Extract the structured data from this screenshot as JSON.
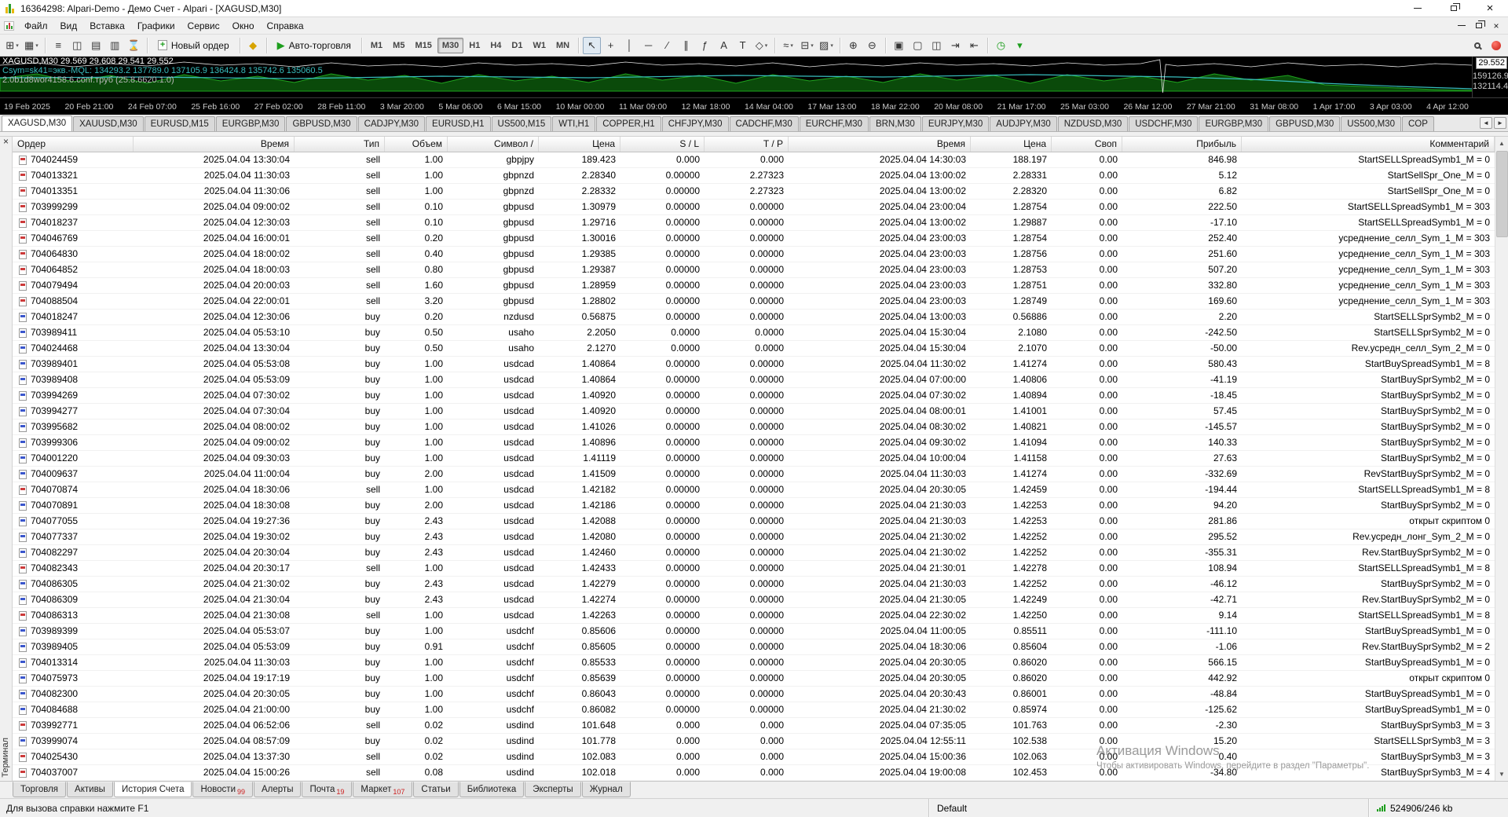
{
  "colors": {
    "sell": "#cc3a3a",
    "buy": "#3a56cc",
    "green": "#1d9e1d",
    "badge": "#cc2020",
    "chart_green": "#1fa51f",
    "chart_green_dark": "#0a4a0a",
    "chart_teal": "#37bdbd",
    "chart_white": "#e6e6e6"
  },
  "window": {
    "title": "16364298: Alpari-Demo - Демо Счет - Alpari - [XAGUSD,M30]",
    "close_glyph": "×",
    "child_close_glyph": "×"
  },
  "menu": {
    "items": [
      "Файл",
      "Вид",
      "Вставка",
      "Графики",
      "Сервис",
      "Окно",
      "Справка"
    ]
  },
  "toolbar": {
    "new_order": {
      "label": "Новый ордер"
    },
    "autotrade": {
      "label": "Авто-торговля",
      "glyph": "▶"
    },
    "metaeditor": {
      "name": "metaeditor-icon",
      "glyph": "◆"
    },
    "chart_group": [
      {
        "name": "new-chart-button",
        "glyph": "⊞",
        "dropdown": "▾"
      },
      {
        "name": "profiles-button",
        "glyph": "▦",
        "dropdown": "▾"
      }
    ],
    "panel_group": [
      {
        "name": "market-watch-button",
        "glyph": "≡"
      },
      {
        "name": "data-window-button",
        "glyph": "◫"
      },
      {
        "name": "navigator-button",
        "glyph": "▤"
      },
      {
        "name": "terminal-button",
        "glyph": "▥"
      },
      {
        "name": "strategy-tester-button",
        "glyph": "⌛"
      }
    ],
    "timeframes": [
      {
        "name": "timeframe-m1-button",
        "label": "M1"
      },
      {
        "name": "timeframe-m5-button",
        "label": "M5"
      },
      {
        "name": "timeframe-m15-button",
        "label": "M15"
      },
      {
        "name": "timeframe-m30-button",
        "label": "M30",
        "active": true
      },
      {
        "name": "timeframe-h1-button",
        "label": "H1"
      },
      {
        "name": "timeframe-h4-button",
        "label": "H4"
      },
      {
        "name": "timeframe-d1-button",
        "label": "D1"
      },
      {
        "name": "timeframe-w1-button",
        "label": "W1"
      },
      {
        "name": "timeframe-mn-button",
        "label": "MN"
      }
    ],
    "draw_group": [
      {
        "name": "cursor-button",
        "glyph": "↖",
        "active": true
      },
      {
        "name": "crosshair-button",
        "glyph": "+"
      },
      {
        "name": "vertical-line-button",
        "glyph": "│"
      },
      {
        "name": "horizontal-line-button",
        "glyph": "─"
      },
      {
        "name": "trendline-button",
        "glyph": "∕"
      },
      {
        "name": "channel-button",
        "glyph": "∥"
      },
      {
        "name": "fibonacci-button",
        "glyph": "ƒ"
      },
      {
        "name": "text-button",
        "glyph": "A"
      },
      {
        "name": "label-button",
        "glyph": "T"
      },
      {
        "name": "shapes-button",
        "glyph": "◇",
        "dropdown": "▾"
      }
    ],
    "chart_tools_group": [
      {
        "name": "indicators-button",
        "glyph": "≈",
        "dropdown": "▾"
      },
      {
        "name": "periodicity-button",
        "glyph": "⊟",
        "dropdown": "▾"
      },
      {
        "name": "templates-button",
        "glyph": "▨",
        "dropdown": "▾"
      }
    ],
    "zoom_group": [
      {
        "name": "zoom-in-button",
        "glyph": "⊕"
      },
      {
        "name": "zoom-out-button",
        "glyph": "⊖"
      }
    ],
    "window_group": [
      {
        "name": "tile-windows-button",
        "glyph": "▣"
      },
      {
        "name": "cascade-windows-button",
        "glyph": "▢"
      },
      {
        "name": "tile-vertical-button",
        "glyph": "◫"
      },
      {
        "name": "auto-scroll-button",
        "glyph": "⇥"
      },
      {
        "name": "chart-shift-button",
        "glyph": "⇤"
      }
    ],
    "misc_group": [
      {
        "name": "scheduler-button",
        "glyph": "◷",
        "cls": "green-glyph"
      },
      {
        "name": "toolbar-options-button",
        "glyph": "▾"
      }
    ]
  },
  "chart": {
    "info_line1": "XAGUSD,M30  29.569 29.608 29.541 29.552",
    "info_line2": "Csym=sk41=экв.-MQL: 134293.2  137789.0  137105.9  136424.8  135742.6  135060.5",
    "info_line3": "2.0b1d8wor4158.6.conf.труб (25.8.6620.1.0)",
    "price_box": "29.552",
    "scale_values": [
      "159126.9",
      "132114.4"
    ],
    "time_axis": [
      "19 Fe&#8203;b 2025",
      "20 Feb 21:00",
      "24 Feb 07:00",
      "25 Feb 16:00",
      "27 Feb 02:00",
      "28 Feb 11:00",
      "3 Mar 20:00",
      "5 Mar 06:00",
      "6 Mar 15:00",
      "10 Mar 00:00",
      "11 Mar 09:00",
      "12 Mar 18:00",
      "14 Mar 04:00",
      "17 Mar 13:00",
      "18 Mar 22:00",
      "20 Mar 08:00",
      "21 Mar 17:00",
      "25 Mar 03:00",
      "26 Mar 12:00",
      "27 Mar 21:00",
      "31 Mar 08:00",
      "1 Apr 17:00",
      "3 Apr 03:00",
      "4 Apr 12:00"
    ]
  },
  "chart_tabs_controls": {
    "left": "◄",
    "right": "►"
  },
  "chart_tabs": [
    {
      "label": "XAGUSD,M30",
      "active": true
    },
    {
      "label": "XAUUSD,M30"
    },
    {
      "label": "EURUSD,M15"
    },
    {
      "label": "EURGBP,M30"
    },
    {
      "label": "GBPUSD,M30"
    },
    {
      "label": "CADJPY,M30"
    },
    {
      "label": "EURUSD,H1"
    },
    {
      "label": "US500,M15"
    },
    {
      "label": "WTI,H1"
    },
    {
      "label": "COPPER,H1"
    },
    {
      "label": "CHFJPY,M30"
    },
    {
      "label": "CADCHF,M30"
    },
    {
      "label": "EURCHF,M30"
    },
    {
      "label": "BRN,M30"
    },
    {
      "label": "EURJPY,M30"
    },
    {
      "label": "AUDJPY,M30"
    },
    {
      "label": "NZDUSD,M30"
    },
    {
      "label": "USDCHF,M30"
    },
    {
      "label": "EURGBP,M30"
    },
    {
      "label": "GBPUSD,M30"
    },
    {
      "label": "US500,M30"
    },
    {
      "label": "COP"
    }
  ],
  "terminal": {
    "caption": "Терминал",
    "close_glyph": "×",
    "scroll_up": "▲",
    "scroll_down": "▼",
    "columns": [
      {
        "label": "Ордер"
      },
      {
        "label": "Время"
      },
      {
        "label": "Тип"
      },
      {
        "label": "Объем"
      },
      {
        "label": "Символ /"
      },
      {
        "label": "Цена"
      },
      {
        "label": "S / L"
      },
      {
        "label": "T / P"
      },
      {
        "label": "Время"
      },
      {
        "label": "Цена"
      },
      {
        "label": "Своп"
      },
      {
        "label": "Прибыль"
      },
      {
        "label": "Комментарий"
      }
    ],
    "rows": [
      [
        "704024459",
        "2025.04.04 13:30:04",
        "sell",
        "1.00",
        "gbpjpy",
        "189.423",
        "0.000",
        "0.000",
        "2025.04.04 14:30:03",
        "188.197",
        "0.00",
        "846.98",
        "StartSELLSpreadSymb1_M = 0"
      ],
      [
        "704013321",
        "2025.04.04 11:30:03",
        "sell",
        "1.00",
        "gbpnzd",
        "2.28340",
        "0.00000",
        "2.27323",
        "2025.04.04 13:00:02",
        "2.28331",
        "0.00",
        "5.12",
        "StartSellSpr_One_M = 0"
      ],
      [
        "704013351",
        "2025.04.04 11:30:06",
        "sell",
        "1.00",
        "gbpnzd",
        "2.28332",
        "0.00000",
        "2.27323",
        "2025.04.04 13:00:02",
        "2.28320",
        "0.00",
        "6.82",
        "StartSellSpr_One_M = 0"
      ],
      [
        "703999299",
        "2025.04.04 09:00:02",
        "sell",
        "0.10",
        "gbpusd",
        "1.30979",
        "0.00000",
        "0.00000",
        "2025.04.04 23:00:04",
        "1.28754",
        "0.00",
        "222.50",
        "StartSELLSpreadSymb1_M = 303"
      ],
      [
        "704018237",
        "2025.04.04 12:30:03",
        "sell",
        "0.10",
        "gbpusd",
        "1.29716",
        "0.00000",
        "0.00000",
        "2025.04.04 13:00:02",
        "1.29887",
        "0.00",
        "-17.10",
        "StartSELLSpreadSymb1_M = 0"
      ],
      [
        "704046769",
        "2025.04.04 16:00:01",
        "sell",
        "0.20",
        "gbpusd",
        "1.30016",
        "0.00000",
        "0.00000",
        "2025.04.04 23:00:03",
        "1.28754",
        "0.00",
        "252.40",
        "усреднение_селл_Sym_1_M = 303"
      ],
      [
        "704064830",
        "2025.04.04 18:00:02",
        "sell",
        "0.40",
        "gbpusd",
        "1.29385",
        "0.00000",
        "0.00000",
        "2025.04.04 23:00:03",
        "1.28756",
        "0.00",
        "251.60",
        "усреднение_селл_Sym_1_M = 303"
      ],
      [
        "704064852",
        "2025.04.04 18:00:03",
        "sell",
        "0.80",
        "gbpusd",
        "1.29387",
        "0.00000",
        "0.00000",
        "2025.04.04 23:00:03",
        "1.28753",
        "0.00",
        "507.20",
        "усреднение_селл_Sym_1_M = 303"
      ],
      [
        "704079494",
        "2025.04.04 20:00:03",
        "sell",
        "1.60",
        "gbpusd",
        "1.28959",
        "0.00000",
        "0.00000",
        "2025.04.04 23:00:03",
        "1.28751",
        "0.00",
        "332.80",
        "усреднение_селл_Sym_1_M = 303"
      ],
      [
        "704088504",
        "2025.04.04 22:00:01",
        "sell",
        "3.20",
        "gbpusd",
        "1.28802",
        "0.00000",
        "0.00000",
        "2025.04.04 23:00:03",
        "1.28749",
        "0.00",
        "169.60",
        "усреднение_селл_Sym_1_M = 303"
      ],
      [
        "704018247",
        "2025.04.04 12:30:06",
        "buy",
        "0.20",
        "nzdusd",
        "0.56875",
        "0.00000",
        "0.00000",
        "2025.04.04 13:00:03",
        "0.56886",
        "0.00",
        "2.20",
        "StartSELLSprSymb2_M = 0"
      ],
      [
        "703989411",
        "2025.04.04 05:53:10",
        "buy",
        "0.50",
        "usaho",
        "2.2050",
        "0.0000",
        "0.0000",
        "2025.04.04 15:30:04",
        "2.1080",
        "0.00",
        "-242.50",
        "StartSELLSprSymb2_M = 0"
      ],
      [
        "704024468",
        "2025.04.04 13:30:04",
        "buy",
        "0.50",
        "usaho",
        "2.1270",
        "0.0000",
        "0.0000",
        "2025.04.04 15:30:04",
        "2.1070",
        "0.00",
        "-50.00",
        "Rev.усредн_селл_Sym_2_M = 0"
      ],
      [
        "703989401",
        "2025.04.04 05:53:08",
        "buy",
        "1.00",
        "usdcad",
        "1.40864",
        "0.00000",
        "0.00000",
        "2025.04.04 11:30:02",
        "1.41274",
        "0.00",
        "580.43",
        "StartBuySpreadSymb1_M = 8"
      ],
      [
        "703989408",
        "2025.04.04 05:53:09",
        "buy",
        "1.00",
        "usdcad",
        "1.40864",
        "0.00000",
        "0.00000",
        "2025.04.04 07:00:00",
        "1.40806",
        "0.00",
        "-41.19",
        "StartBuySprSymb2_M = 0"
      ],
      [
        "703994269",
        "2025.04.04 07:30:02",
        "buy",
        "1.00",
        "usdcad",
        "1.40920",
        "0.00000",
        "0.00000",
        "2025.04.04 07:30:02",
        "1.40894",
        "0.00",
        "-18.45",
        "StartBuySprSymb2_M = 0"
      ],
      [
        "703994277",
        "2025.04.04 07:30:04",
        "buy",
        "1.00",
        "usdcad",
        "1.40920",
        "0.00000",
        "0.00000",
        "2025.04.04 08:00:01",
        "1.41001",
        "0.00",
        "57.45",
        "StartBuySprSymb2_M = 0"
      ],
      [
        "703995682",
        "2025.04.04 08:00:02",
        "buy",
        "1.00",
        "usdcad",
        "1.41026",
        "0.00000",
        "0.00000",
        "2025.04.04 08:30:02",
        "1.40821",
        "0.00",
        "-145.57",
        "StartBuySprSymb2_M = 0"
      ],
      [
        "703999306",
        "2025.04.04 09:00:02",
        "buy",
        "1.00",
        "usdcad",
        "1.40896",
        "0.00000",
        "0.00000",
        "2025.04.04 09:30:02",
        "1.41094",
        "0.00",
        "140.33",
        "StartBuySprSymb2_M = 0"
      ],
      [
        "704001220",
        "2025.04.04 09:30:03",
        "buy",
        "1.00",
        "usdcad",
        "1.41119",
        "0.00000",
        "0.00000",
        "2025.04.04 10:00:04",
        "1.41158",
        "0.00",
        "27.63",
        "StartBuySprSymb2_M = 0"
      ],
      [
        "704009637",
        "2025.04.04 11:00:04",
        "buy",
        "2.00",
        "usdcad",
        "1.41509",
        "0.00000",
        "0.00000",
        "2025.04.04 11:30:03",
        "1.41274",
        "0.00",
        "-332.69",
        "RevStartBuySprSymb2_M = 0"
      ],
      [
        "704070874",
        "2025.04.04 18:30:06",
        "sell",
        "1.00",
        "usdcad",
        "1.42182",
        "0.00000",
        "0.00000",
        "2025.04.04 20:30:05",
        "1.42459",
        "0.00",
        "-194.44",
        "StartSELLSpreadSymb1_M = 8"
      ],
      [
        "704070891",
        "2025.04.04 18:30:08",
        "buy",
        "2.00",
        "usdcad",
        "1.42186",
        "0.00000",
        "0.00000",
        "2025.04.04 21:30:03",
        "1.42253",
        "0.00",
        "94.20",
        "StartBuySprSymb2_M = 0"
      ],
      [
        "704077055",
        "2025.04.04 19:27:36",
        "buy",
        "2.43",
        "usdcad",
        "1.42088",
        "0.00000",
        "0.00000",
        "2025.04.04 21:30:03",
        "1.42253",
        "0.00",
        "281.86",
        "открыт скриптом 0"
      ],
      [
        "704077337",
        "2025.04.04 19:30:02",
        "buy",
        "2.43",
        "usdcad",
        "1.42080",
        "0.00000",
        "0.00000",
        "2025.04.04 21:30:02",
        "1.42252",
        "0.00",
        "295.52",
        "Rev.усредн_лонг_Sym_2_M = 0"
      ],
      [
        "704082297",
        "2025.04.04 20:30:04",
        "buy",
        "2.43",
        "usdcad",
        "1.42460",
        "0.00000",
        "0.00000",
        "2025.04.04 21:30:02",
        "1.42252",
        "0.00",
        "-355.31",
        "Rev.StartBuySprSymb2_M = 0"
      ],
      [
        "704082343",
        "2025.04.04 20:30:17",
        "sell",
        "1.00",
        "usdcad",
        "1.42433",
        "0.00000",
        "0.00000",
        "2025.04.04 21:30:01",
        "1.42278",
        "0.00",
        "108.94",
        "StartSELLSpreadSymb1_M = 8"
      ],
      [
        "704086305",
        "2025.04.04 21:30:02",
        "buy",
        "2.43",
        "usdcad",
        "1.42279",
        "0.00000",
        "0.00000",
        "2025.04.04 21:30:03",
        "1.42252",
        "0.00",
        "-46.12",
        "StartBuySprSymb2_M = 0"
      ],
      [
        "704086309",
        "2025.04.04 21:30:04",
        "buy",
        "2.43",
        "usdcad",
        "1.42274",
        "0.00000",
        "0.00000",
        "2025.04.04 21:30:05",
        "1.42249",
        "0.00",
        "-42.71",
        "Rev.StartBuySprSymb2_M = 0"
      ],
      [
        "704086313",
        "2025.04.04 21:30:08",
        "sell",
        "1.00",
        "usdcad",
        "1.42263",
        "0.00000",
        "0.00000",
        "2025.04.04 22:30:02",
        "1.42250",
        "0.00",
        "9.14",
        "StartSELLSpreadSymb1_M = 8"
      ],
      [
        "703989399",
        "2025.04.04 05:53:07",
        "buy",
        "1.00",
        "usdchf",
        "0.85606",
        "0.00000",
        "0.00000",
        "2025.04.04 11:00:05",
        "0.85511",
        "0.00",
        "-111.10",
        "StartBuySpreadSymb1_M = 0"
      ],
      [
        "703989405",
        "2025.04.04 05:53:09",
        "buy",
        "0.91",
        "usdchf",
        "0.85605",
        "0.00000",
        "0.00000",
        "2025.04.04 18:30:06",
        "0.85604",
        "0.00",
        "-1.06",
        "Rev.StartBuySprSymb2_M = 2"
      ],
      [
        "704013314",
        "2025.04.04 11:30:03",
        "buy",
        "1.00",
        "usdchf",
        "0.85533",
        "0.00000",
        "0.00000",
        "2025.04.04 20:30:05",
        "0.86020",
        "0.00",
        "566.15",
        "StartBuySpreadSymb1_M = 0"
      ],
      [
        "704075973",
        "2025.04.04 19:17:19",
        "buy",
        "1.00",
        "usdchf",
        "0.85639",
        "0.00000",
        "0.00000",
        "2025.04.04 20:30:05",
        "0.86020",
        "0.00",
        "442.92",
        "открыт скриптом 0"
      ],
      [
        "704082300",
        "2025.04.04 20:30:05",
        "buy",
        "1.00",
        "usdchf",
        "0.86043",
        "0.00000",
        "0.00000",
        "2025.04.04 20:30:43",
        "0.86001",
        "0.00",
        "-48.84",
        "StartBuySpreadSymb1_M = 0"
      ],
      [
        "704084688",
        "2025.04.04 21:00:00",
        "buy",
        "1.00",
        "usdchf",
        "0.86082",
        "0.00000",
        "0.00000",
        "2025.04.04 21:30:02",
        "0.85974",
        "0.00",
        "-125.62",
        "StartBuySpreadSymb1_M = 0"
      ],
      [
        "703992771",
        "2025.04.04 06:52:06",
        "sell",
        "0.02",
        "usdind",
        "101.648",
        "0.000",
        "0.000",
        "2025.04.04 07:35:05",
        "101.763",
        "0.00",
        "-2.30",
        "StartBuySprSymb3_M = 3"
      ],
      [
        "703999074",
        "2025.04.04 08:57:09",
        "buy",
        "0.02",
        "usdind",
        "101.778",
        "0.000",
        "0.000",
        "2025.04.04 12:55:11",
        "102.538",
        "0.00",
        "15.20",
        "StartSELLSprSymb3_M = 3"
      ],
      [
        "704025430",
        "2025.04.04 13:37:30",
        "sell",
        "0.02",
        "usdind",
        "102.083",
        "0.000",
        "0.000",
        "2025.04.04 15:00:36",
        "102.063",
        "0.00",
        "0.40",
        "StartBuySprSymb3_M = 3"
      ],
      [
        "704037007",
        "2025.04.04 15:00:26",
        "sell",
        "0.08",
        "usdind",
        "102.018",
        "0.000",
        "0.000",
        "2025.04.04 19:00:08",
        "102.453",
        "0.00",
        "-34.80",
        "StartBuySprSymb3_M = 4"
      ]
    ]
  },
  "bottom_tabs": [
    {
      "label": "Торговля"
    },
    {
      "label": "Активы"
    },
    {
      "label": "История Счета",
      "active": true
    },
    {
      "label": "Новости",
      "badge": "99"
    },
    {
      "label": "Алерты"
    },
    {
      "label": "Почта",
      "badge": "19"
    },
    {
      "label": "Маркет",
      "badge": "107"
    },
    {
      "label": "Статьи"
    },
    {
      "label": "Библиотека"
    },
    {
      "label": "Эксперты"
    },
    {
      "label": "Журнал"
    }
  ],
  "statusbar": {
    "help": "Для вызова справки нажмите F1",
    "profile": "Default",
    "traffic": "524906/246 kb"
  },
  "watermark": {
    "line1": "Активация Windows",
    "line2": "Чтобы активировать Windows, перейдите в раздел \"Параметры\"."
  }
}
